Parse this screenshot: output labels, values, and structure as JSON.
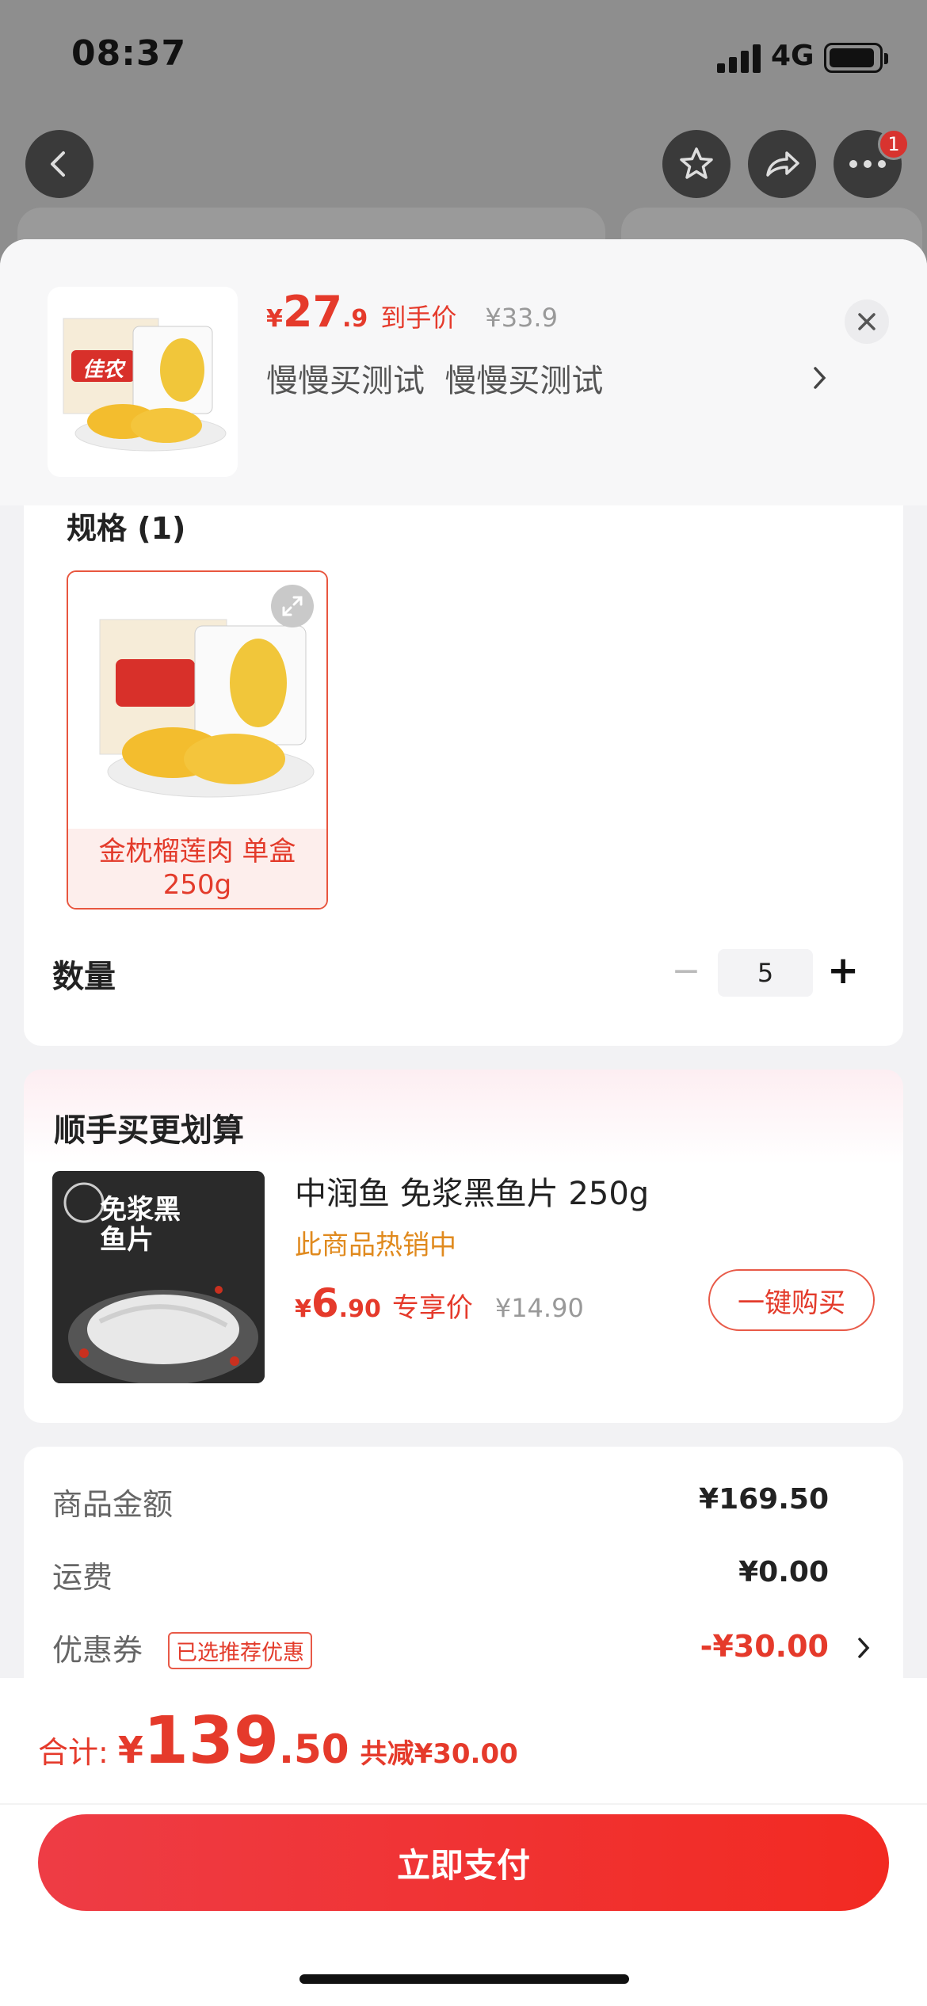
{
  "status": {
    "time": "08:37",
    "network": "4G"
  },
  "nav": {
    "badge_count": "1"
  },
  "product": {
    "price_symbol": "¥",
    "price_int": "27",
    "price_dec": ".9",
    "price_tag": "到手价",
    "original_price": "¥33.9",
    "selected_desc": "慢慢买测试  慢慢买测试",
    "thumb_brand": "佳农"
  },
  "spec": {
    "title": "规格 (1)",
    "option_label": "金枕榴莲肉 单盒 250g"
  },
  "quantity": {
    "label": "数量",
    "value": "5",
    "minus": "−",
    "plus": "+"
  },
  "addon": {
    "title": "顺手买更划算",
    "name": "中润鱼 免浆黑鱼片 250g",
    "hot": "此商品热销中",
    "price_symbol": "¥",
    "price_int": "6",
    "price_dec": ".90",
    "price_tag": "专享价",
    "original_price": "¥14.90",
    "buy_label": "一键购买",
    "img_text": "免浆黑鱼片"
  },
  "summary": {
    "goods_label": "商品金额",
    "goods_value": "¥169.50",
    "shipping_label": "运费",
    "shipping_value": "¥0.00",
    "coupon_label": "优惠券",
    "coupon_tag": "已选推荐优惠",
    "coupon_value": "-¥30.00"
  },
  "footer": {
    "total_label": "合计:",
    "total_symbol": "¥",
    "total_int": "139",
    "total_dec": ".50",
    "saved": "共减¥30.00",
    "pay_label": "立即支付"
  },
  "colors": {
    "accent": "#e53a2b",
    "orange": "#e08a1e",
    "sheet_bg": "#f2f2f4"
  }
}
